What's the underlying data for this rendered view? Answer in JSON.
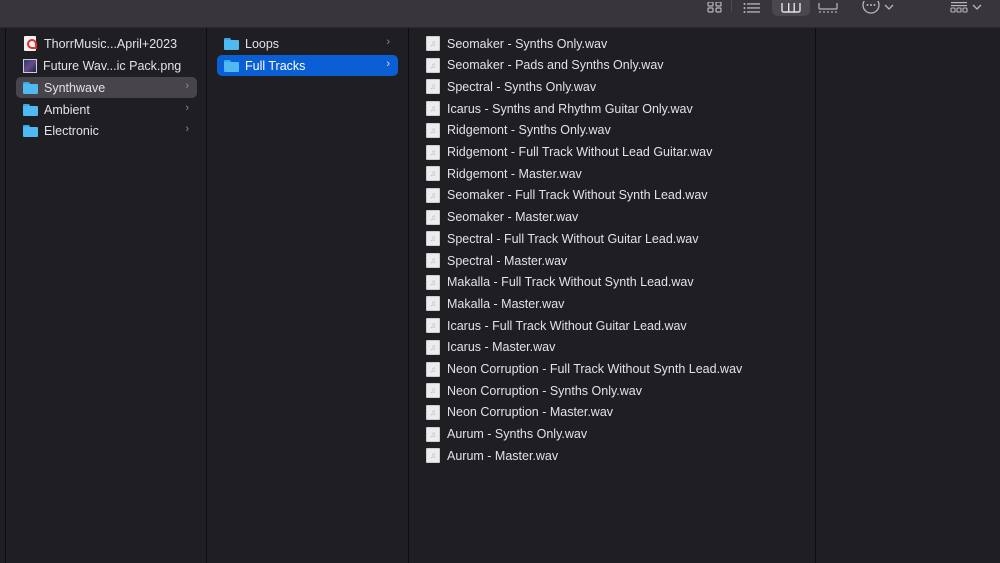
{
  "toolbar": {
    "view_buttons": [
      {
        "name": "icon-view-button",
        "icon": "grid-icon",
        "active": false
      },
      {
        "name": "list-view-button",
        "icon": "list-icon",
        "active": false
      },
      {
        "name": "column-view-button",
        "icon": "columns-icon",
        "active": true
      },
      {
        "name": "gallery-view-button",
        "icon": "gallery-icon",
        "active": false
      }
    ],
    "action_button": {
      "icon": "ellipsis-circle-icon",
      "chevron": "chevron-down-icon"
    },
    "group_button": {
      "icon": "group-grid-icon",
      "chevron": "chevron-down-icon"
    }
  },
  "columns": [
    {
      "items": [
        {
          "label": "ThorrMusic...April+2023",
          "type": "pdf",
          "selected": false,
          "has_children": false
        },
        {
          "label": "Future Wav...ic Pack.png",
          "type": "image",
          "selected": false,
          "has_children": false
        },
        {
          "label": "Synthwave",
          "type": "folder",
          "selected": "inactive",
          "has_children": true
        },
        {
          "label": "Ambient",
          "type": "folder",
          "selected": false,
          "has_children": true
        },
        {
          "label": "Electronic",
          "type": "folder",
          "selected": false,
          "has_children": true
        }
      ]
    },
    {
      "items": [
        {
          "label": "Loops",
          "type": "folder",
          "selected": false,
          "has_children": true
        },
        {
          "label": "Full Tracks",
          "type": "folder",
          "selected": "active",
          "has_children": true
        }
      ]
    },
    {
      "items": [
        {
          "label": "Seomaker - Synths Only.wav",
          "type": "audio"
        },
        {
          "label": "Seomaker - Pads and Synths Only.wav",
          "type": "audio"
        },
        {
          "label": "Spectral - Synths Only.wav",
          "type": "audio"
        },
        {
          "label": "Icarus - Synths and Rhythm Guitar Only.wav",
          "type": "audio"
        },
        {
          "label": "Ridgemont - Synths Only.wav",
          "type": "audio"
        },
        {
          "label": "Ridgemont - Full Track Without Lead Guitar.wav",
          "type": "audio"
        },
        {
          "label": "Ridgemont - Master.wav",
          "type": "audio"
        },
        {
          "label": "Seomaker - Full Track Without Synth Lead.wav",
          "type": "audio"
        },
        {
          "label": "Seomaker - Master.wav",
          "type": "audio"
        },
        {
          "label": "Spectral - Full Track Without Guitar Lead.wav",
          "type": "audio"
        },
        {
          "label": "Spectral - Master.wav",
          "type": "audio"
        },
        {
          "label": "Makalla - Full Track Without Synth Lead.wav",
          "type": "audio"
        },
        {
          "label": "Makalla - Master.wav",
          "type": "audio"
        },
        {
          "label": "Icarus - Full Track Without Guitar Lead.wav",
          "type": "audio"
        },
        {
          "label": "Icarus - Master.wav",
          "type": "audio"
        },
        {
          "label": "Neon Corruption - Full Track Without Synth Lead.wav",
          "type": "audio"
        },
        {
          "label": "Neon Corruption - Synths Only.wav",
          "type": "audio"
        },
        {
          "label": "Neon Corruption - Master.wav",
          "type": "audio"
        },
        {
          "label": "Aurum - Synths Only.wav",
          "type": "audio"
        },
        {
          "label": "Aurum - Master.wav",
          "type": "audio"
        }
      ]
    },
    {
      "items": []
    }
  ],
  "glyphs": {
    "chevron_right": "›",
    "music_note": "♫"
  },
  "colors": {
    "selection_active": "#0b5fd4",
    "selection_inactive": "#47454b",
    "folder": "#4fb9f2"
  }
}
